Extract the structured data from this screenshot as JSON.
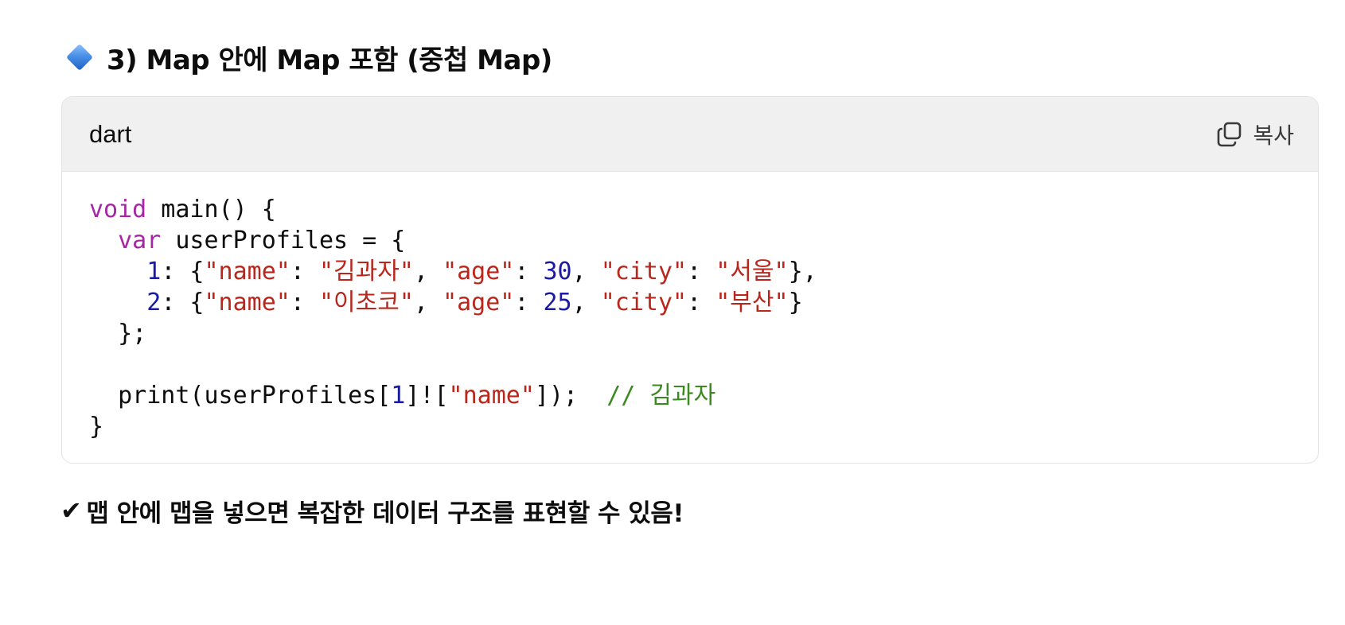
{
  "heading": {
    "icon": "blue-diamond-icon",
    "text": "3) Map 안에 Map 포함 (중첩 Map)"
  },
  "code_block": {
    "language": "dart",
    "copy_label": "복사",
    "copy_icon": "copy-icon",
    "lines": [
      [
        {
          "t": "void",
          "c": "kw"
        },
        {
          "t": " main() {",
          "c": ""
        }
      ],
      [
        {
          "t": "  ",
          "c": ""
        },
        {
          "t": "var",
          "c": "kw"
        },
        {
          "t": " userProfiles = {",
          "c": ""
        }
      ],
      [
        {
          "t": "    ",
          "c": ""
        },
        {
          "t": "1",
          "c": "num"
        },
        {
          "t": ": {",
          "c": ""
        },
        {
          "t": "\"name\"",
          "c": "str"
        },
        {
          "t": ": ",
          "c": ""
        },
        {
          "t": "\"김과자\"",
          "c": "str"
        },
        {
          "t": ", ",
          "c": ""
        },
        {
          "t": "\"age\"",
          "c": "str"
        },
        {
          "t": ": ",
          "c": ""
        },
        {
          "t": "30",
          "c": "num"
        },
        {
          "t": ", ",
          "c": ""
        },
        {
          "t": "\"city\"",
          "c": "str"
        },
        {
          "t": ": ",
          "c": ""
        },
        {
          "t": "\"서울\"",
          "c": "str"
        },
        {
          "t": "},",
          "c": ""
        }
      ],
      [
        {
          "t": "    ",
          "c": ""
        },
        {
          "t": "2",
          "c": "num"
        },
        {
          "t": ": {",
          "c": ""
        },
        {
          "t": "\"name\"",
          "c": "str"
        },
        {
          "t": ": ",
          "c": ""
        },
        {
          "t": "\"이초코\"",
          "c": "str"
        },
        {
          "t": ", ",
          "c": ""
        },
        {
          "t": "\"age\"",
          "c": "str"
        },
        {
          "t": ": ",
          "c": ""
        },
        {
          "t": "25",
          "c": "num"
        },
        {
          "t": ", ",
          "c": ""
        },
        {
          "t": "\"city\"",
          "c": "str"
        },
        {
          "t": ": ",
          "c": ""
        },
        {
          "t": "\"부산\"",
          "c": "str"
        },
        {
          "t": "}",
          "c": ""
        }
      ],
      [
        {
          "t": "  };",
          "c": ""
        }
      ],
      [],
      [
        {
          "t": "  print(userProfiles[",
          "c": ""
        },
        {
          "t": "1",
          "c": "num"
        },
        {
          "t": "]![",
          "c": ""
        },
        {
          "t": "\"name\"",
          "c": "str"
        },
        {
          "t": "]);  ",
          "c": ""
        },
        {
          "t": "// 김과자",
          "c": "cmt"
        }
      ],
      [
        {
          "t": "}",
          "c": ""
        }
      ]
    ]
  },
  "note": {
    "icon": "check-mark-icon",
    "check_glyph": "✔",
    "text": "맵 안에 맵을 넣으면 복잡한 데이터 구조를 표현할 수 있음!"
  },
  "colors": {
    "keyword": "#a626a4",
    "string": "#b9261c",
    "number": "#1a1aa6",
    "comment": "#3a8a1f",
    "header_bg": "#f0f0f0"
  }
}
